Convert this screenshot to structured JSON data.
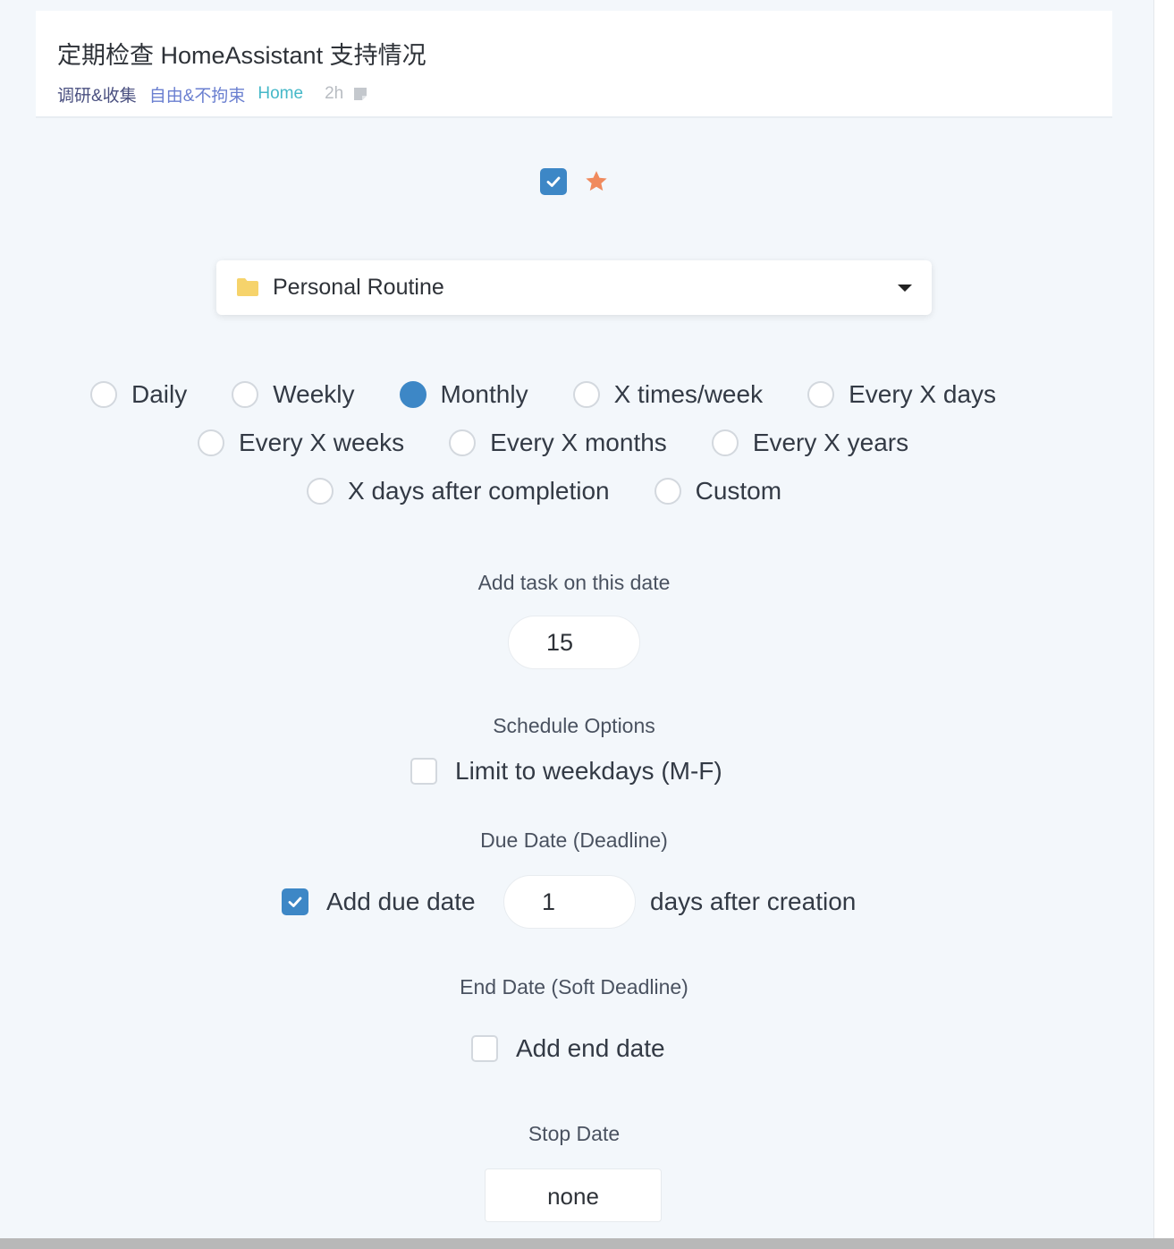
{
  "task": {
    "title": "定期检查 HomeAssistant 支持情况",
    "tags": [
      "调研&收集",
      "自由&不拘束",
      "Home"
    ],
    "age": "2h"
  },
  "top_controls": {
    "completed_checked": true,
    "starred": true,
    "star_color": "#f08a5d",
    "check_color": "#3d87c6"
  },
  "project_dropdown": {
    "selected": "Personal Routine",
    "icon": "folder-icon",
    "icon_color": "#f6d36b"
  },
  "frequency": {
    "options": [
      "Daily",
      "Weekly",
      "Monthly",
      "X times/week",
      "Every X days",
      "Every X weeks",
      "Every X months",
      "Every X years",
      "X days after completion",
      "Custom"
    ],
    "selected": "Monthly"
  },
  "add_task_date": {
    "label": "Add task on this date",
    "value": "15"
  },
  "schedule_options": {
    "label": "Schedule Options",
    "weekdays_label": "Limit to weekdays (M-F)",
    "weekdays_checked": false
  },
  "due_date": {
    "label": "Due Date (Deadline)",
    "checkbox_label": "Add due date",
    "checked": true,
    "days": "1",
    "suffix": "days after creation"
  },
  "end_date": {
    "label": "End Date (Soft Deadline)",
    "checkbox_label": "Add end date",
    "checked": false
  },
  "stop_date": {
    "label": "Stop Date",
    "value": "none"
  }
}
